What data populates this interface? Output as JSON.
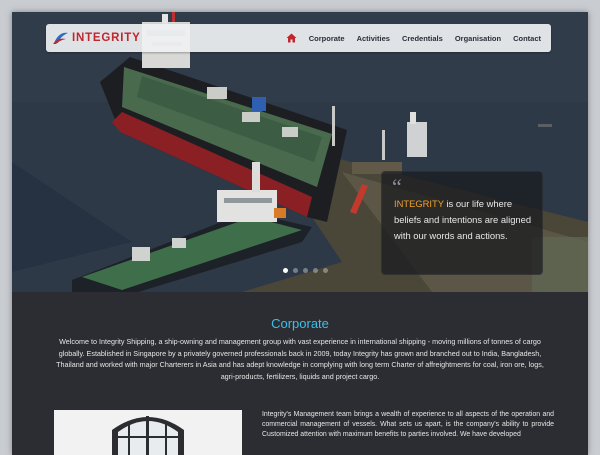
{
  "nav": {
    "logo_text": "INTEGRITY",
    "home_icon": "home-icon",
    "items": [
      "Corporate",
      "Activities",
      "Credentials",
      "Organisation",
      "Contact"
    ],
    "active": "Corporate"
  },
  "hero": {
    "quote_brand": "INTEGRITY",
    "quote_rest": " is our life where beliefs and intentions are aligned with our words and actions.",
    "slide_count": 5,
    "active_slide": 1
  },
  "corporate": {
    "title": "Corporate",
    "intro": "Welcome to Integrity Shipping, a ship-owning and management group with vast experience in international shipping - moving millions of tonnes of cargo globally. Established in Singapore by a privately governed professionals back in 2009, today Integrity has grown and branched out to India, Bangladesh, Thailand and worked with major Charterers in Asia and has adept knowledge in complying with long term Charter of affreightments for coal, iron ore, logs, agri-products, fertilizers, liquids and project cargo.",
    "management": "Integrity's Management team brings a wealth of experience to all aspects of the operation and commercial management of vessels. What sets us apart, is the company's ability to provide Customized attention with maximum benefits to parties involved. We have developed"
  },
  "colors": {
    "accent": "#3dc0e8",
    "brand_red": "#c0262d",
    "quote_highlight": "#f0a02c"
  }
}
